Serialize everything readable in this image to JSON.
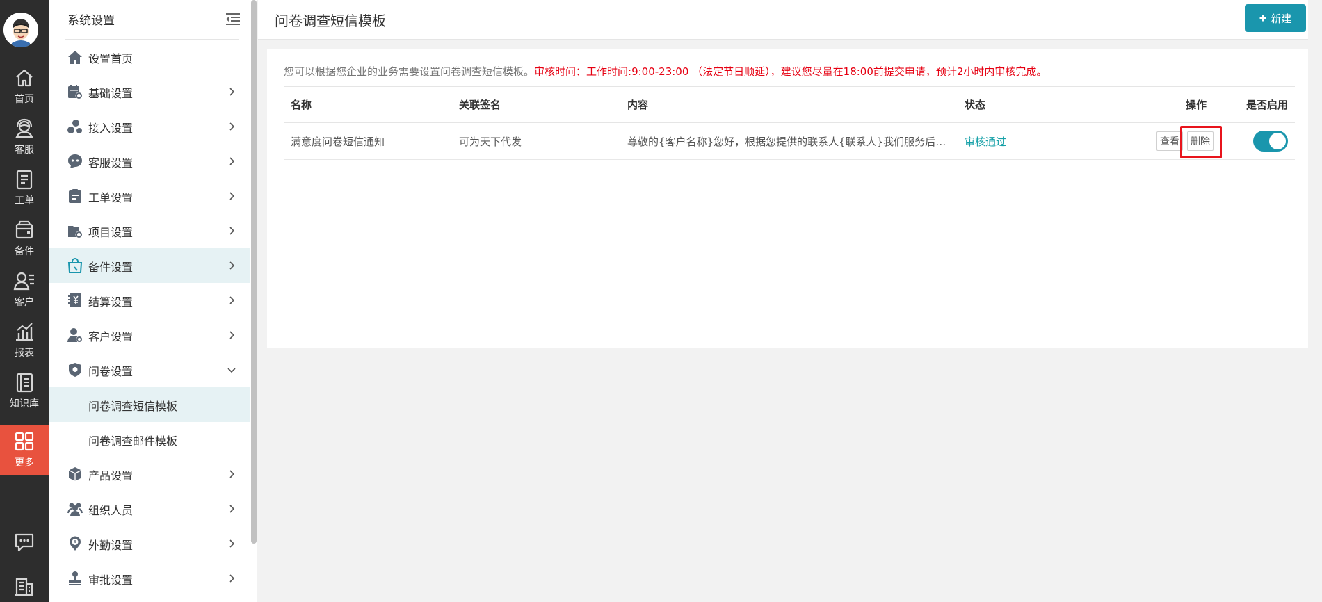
{
  "rail": {
    "items": [
      {
        "label": "首页",
        "icon": "home-icon"
      },
      {
        "label": "客服",
        "icon": "headset-icon"
      },
      {
        "label": "工单",
        "icon": "clipboard-icon"
      },
      {
        "label": "备件",
        "icon": "box-icon"
      },
      {
        "label": "客户",
        "icon": "contacts-icon"
      },
      {
        "label": "报表",
        "icon": "chart-icon"
      },
      {
        "label": "知识库",
        "icon": "book-icon"
      },
      {
        "label": "更多",
        "icon": "grid-icon"
      }
    ],
    "active": "更多"
  },
  "sidebar": {
    "title": "系统设置",
    "items": [
      {
        "label": "设置首页"
      },
      {
        "label": "基础设置"
      },
      {
        "label": "接入设置"
      },
      {
        "label": "客服设置"
      },
      {
        "label": "工单设置"
      },
      {
        "label": "项目设置"
      },
      {
        "label": "备件设置"
      },
      {
        "label": "结算设置"
      },
      {
        "label": "客户设置"
      },
      {
        "label": "问卷设置"
      },
      {
        "label": "问卷调查短信模板"
      },
      {
        "label": "问卷调查邮件模板"
      },
      {
        "label": "产品设置"
      },
      {
        "label": "组织人员"
      },
      {
        "label": "外勤设置"
      },
      {
        "label": "审批设置"
      }
    ]
  },
  "header": {
    "title": "问卷调查短信模板",
    "new_button": "新建"
  },
  "notice": {
    "grey": "您可以根据您企业的业务需要设置问卷调查短信模板。",
    "red": "审核时间：工作时间:9:00-23:00 （法定节日顺延），建议您尽量在18:00前提交申请，预计2小时内审核完成。"
  },
  "table": {
    "headers": [
      "名称",
      "关联签名",
      "内容",
      "状态",
      "操作",
      "是否启用"
    ],
    "rows": [
      {
        "name": "满意度问卷短信通知",
        "signature": "可为天下代发",
        "content": "尊敬的{客户名称}您好，根据您提供的联系人{联系人}我们服务后推...",
        "status": "审核通过",
        "view": "查看",
        "delete": "删除",
        "enabled": true
      }
    ]
  },
  "colors": {
    "accent": "#1a96ad",
    "rail_bg": "#2d2d2d",
    "rail_active": "#e8523e",
    "notice_red": "#e60012",
    "status_green": "#17a1a8",
    "highlight_bg": "#e6f2f4"
  }
}
